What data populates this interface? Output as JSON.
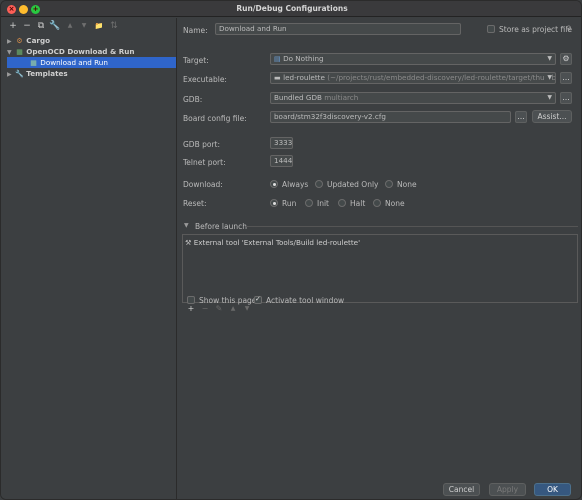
{
  "window": {
    "title": "Run/Debug Configurations"
  },
  "toolbar": {
    "add": "+",
    "remove": "−",
    "copy": "⧉",
    "settings": "🔧",
    "up": "▲",
    "down": "▼",
    "folder": "📁",
    "sort": "⇅"
  },
  "tree": {
    "cargo": "Cargo",
    "openocd": "OpenOCD Download & Run",
    "download_run": "Download and Run",
    "templates": "Templates"
  },
  "form": {
    "name_label": "Name:",
    "name_value": "Download and Run",
    "store_label": "Store as project file",
    "target_label": "Target:",
    "target_value": "Do Nothing",
    "executable_label": "Executable:",
    "executable_name": "led-roulette",
    "executable_path": "(~/projects/rust/embedded-discovery/led-roulette/target/thumbv",
    "gdb_label": "GDB:",
    "gdb_value": "Bundled GDB",
    "gdb_hint": "multiarch",
    "board_label": "Board config file:",
    "board_value": "board/stm32f3discovery-v2.cfg",
    "assist_label": "Assist...",
    "ellipsis": "...",
    "gdb_port_label": "GDB port:",
    "gdb_port_value": "3333",
    "telnet_port_label": "Telnet port:",
    "telnet_port_value": "1444",
    "download_label": "Download:",
    "download_options": [
      "Always",
      "Updated Only",
      "None"
    ],
    "reset_label": "Reset:",
    "reset_options": [
      "Run",
      "Init",
      "Halt",
      "None"
    ]
  },
  "before_launch": {
    "header": "Before launch",
    "item": "External tool 'External Tools/Build led-roulette'",
    "show_page": "Show this page",
    "activate_tool": "Activate tool window"
  },
  "footer": {
    "help": "?",
    "cancel": "Cancel",
    "apply": "Apply",
    "ok": "OK"
  },
  "colors": {
    "accent": "#2f65ca",
    "primary_button": "#365880",
    "background": "#3c3f41"
  }
}
